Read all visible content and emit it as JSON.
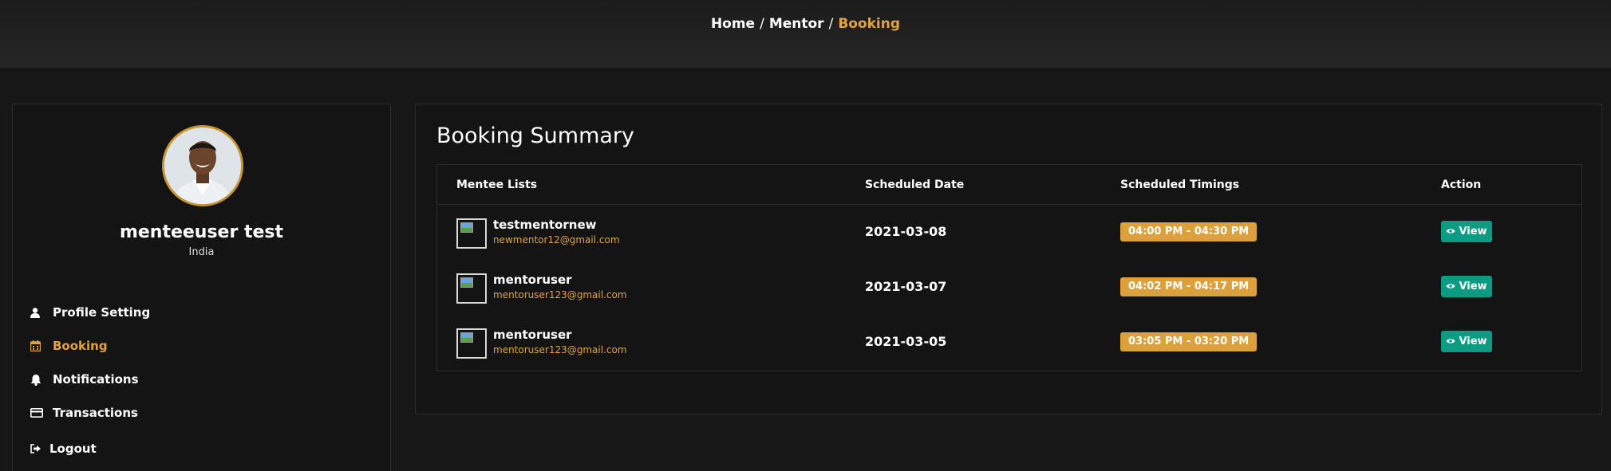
{
  "breadcrumb": {
    "home": "Home",
    "separator": "/",
    "mentor": "Mentor",
    "current": "Booking"
  },
  "profile": {
    "name": "menteeuser test",
    "country": "India"
  },
  "menu": [
    {
      "label": "Profile Setting",
      "icon": "user-icon"
    },
    {
      "label": "Booking",
      "icon": "calendar-icon",
      "active": true
    },
    {
      "label": "Notifications",
      "icon": "bell-icon"
    },
    {
      "label": "Transactions",
      "icon": "credit-card-icon"
    },
    {
      "label": "Logout",
      "icon": "sign-out-icon"
    }
  ],
  "main": {
    "title": "Booking Summary",
    "columns": [
      "Mentee Lists",
      "Scheduled Date",
      "Scheduled Timings",
      "Action"
    ],
    "rows": [
      {
        "name": "testmentornew",
        "email": "newmentor12@gmail.com",
        "date": "2021-03-08",
        "time": "04:00 PM - 04:30 PM",
        "action": "View"
      },
      {
        "name": "mentoruser",
        "email": "mentoruser123@gmail.com",
        "date": "2021-03-07",
        "time": "04:02 PM - 04:17 PM",
        "action": "View"
      },
      {
        "name": "mentoruser",
        "email": "mentoruser123@gmail.com",
        "date": "2021-03-05",
        "time": "03:05 PM - 03:20 PM",
        "action": "View"
      }
    ]
  },
  "colors": {
    "accent": "#e1a33f",
    "badge": "#dca13d",
    "view_button": "#0e9b84",
    "background": "#171717"
  }
}
